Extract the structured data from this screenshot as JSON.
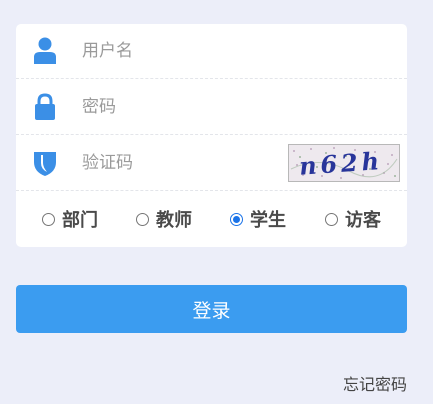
{
  "form": {
    "username_placeholder": "用户名",
    "password_placeholder": "密码",
    "captcha_placeholder": "验证码",
    "captcha_image_text": "n62h"
  },
  "roles": [
    {
      "label": "部门",
      "checked": false
    },
    {
      "label": "教师",
      "checked": false
    },
    {
      "label": "学生",
      "checked": true
    },
    {
      "label": "访客",
      "checked": false
    }
  ],
  "login_label": "登录",
  "forgot_label": "忘记密码",
  "colors": {
    "icon_blue": "#3b8fe6",
    "button_blue": "#3b9cf0",
    "background": "#eceef9"
  },
  "icons": {
    "username": "user-icon",
    "password": "lock-icon",
    "captcha": "shield-icon"
  }
}
